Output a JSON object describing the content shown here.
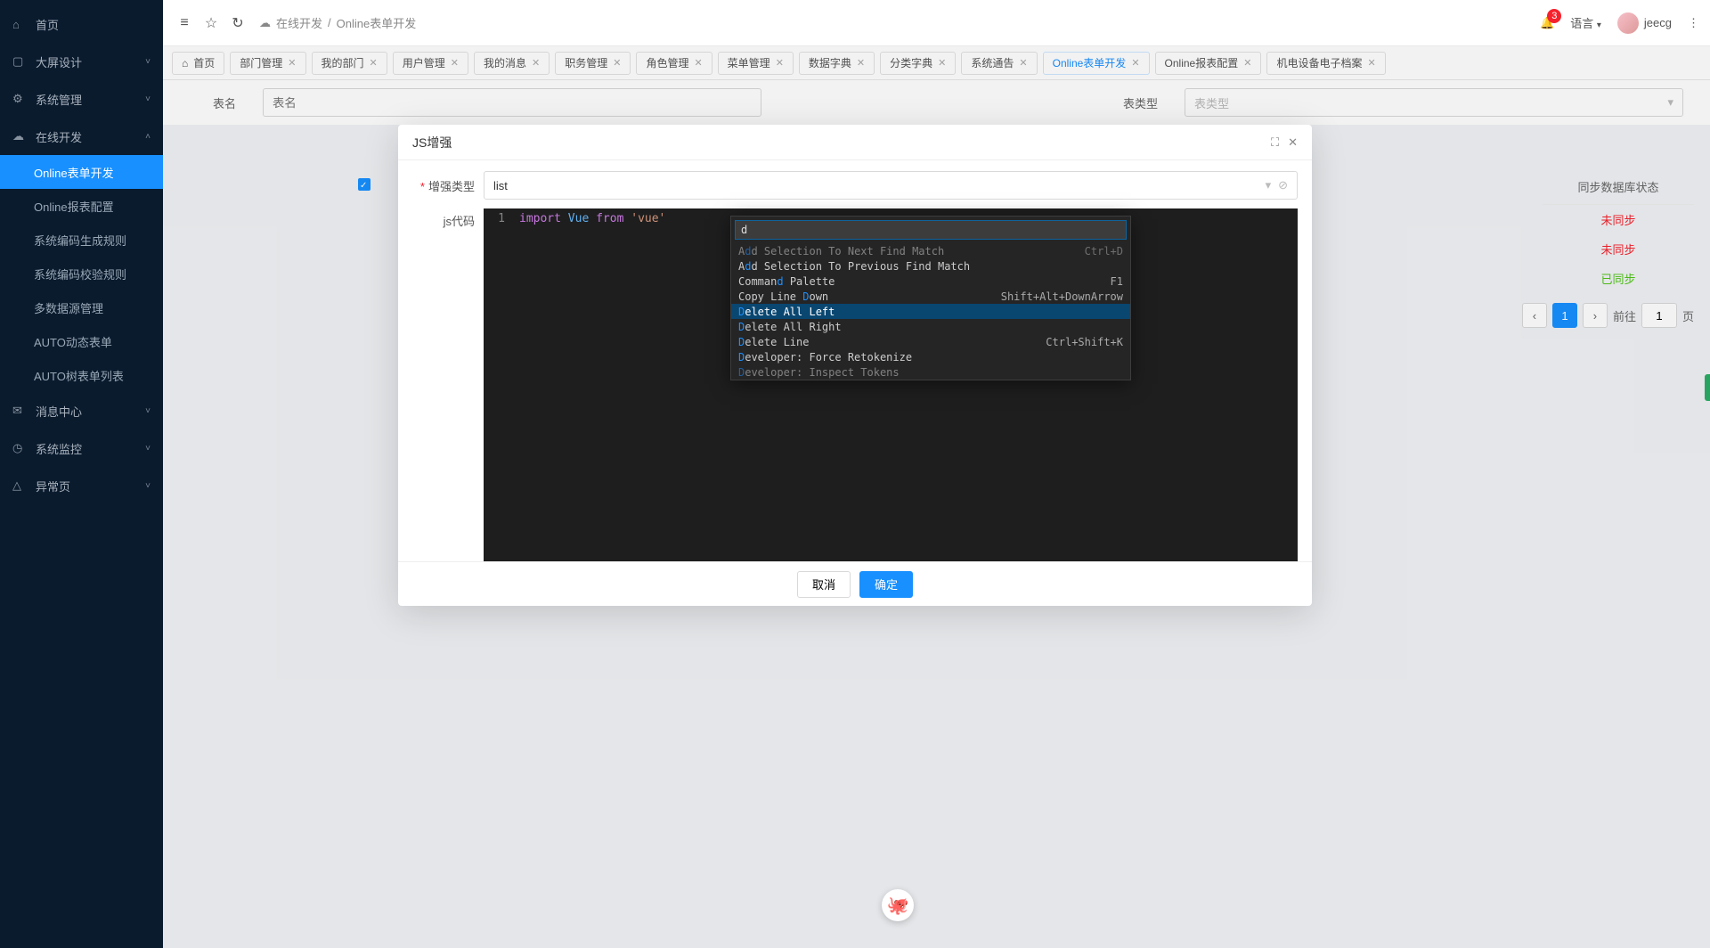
{
  "sidebar": {
    "items": [
      {
        "icon": "⌂",
        "label": "首页",
        "expandable": false
      },
      {
        "icon": "▢",
        "label": "大屏设计",
        "expandable": true
      },
      {
        "icon": "⚙",
        "label": "系统管理",
        "expandable": true
      },
      {
        "icon": "☁",
        "label": "在线开发",
        "expandable": true,
        "open": true,
        "children": [
          {
            "label": "Online表单开发",
            "active": true
          },
          {
            "label": "Online报表配置"
          },
          {
            "label": "系统编码生成规则"
          },
          {
            "label": "系统编码校验规则"
          },
          {
            "label": "多数据源管理"
          },
          {
            "label": "AUTO动态表单"
          },
          {
            "label": "AUTO树表单列表"
          }
        ]
      },
      {
        "icon": "✉",
        "label": "消息中心",
        "expandable": true
      },
      {
        "icon": "◷",
        "label": "系统监控",
        "expandable": true
      },
      {
        "icon": "△",
        "label": "异常页",
        "expandable": true
      }
    ]
  },
  "topbar": {
    "breadcrumb": {
      "icon_label": "在线开发",
      "current": "Online表单开发",
      "sep": "/"
    },
    "language_label": "语言",
    "user_name": "jeecg",
    "badge_count": "3"
  },
  "tabs": [
    {
      "label": "首页",
      "icon": "⌂",
      "closable": false
    },
    {
      "label": "部门管理"
    },
    {
      "label": "我的部门"
    },
    {
      "label": "用户管理"
    },
    {
      "label": "我的消息"
    },
    {
      "label": "职务管理"
    },
    {
      "label": "角色管理"
    },
    {
      "label": "菜单管理"
    },
    {
      "label": "数据字典"
    },
    {
      "label": "分类字典"
    },
    {
      "label": "系统通告"
    },
    {
      "label": "Online表单开发",
      "active": true
    },
    {
      "label": "Online报表配置"
    },
    {
      "label": "机电设备电子档案"
    }
  ],
  "search": {
    "name_label": "表名",
    "name_placeholder": "表名",
    "type_label": "表类型",
    "type_placeholder": "表类型"
  },
  "table": {
    "sync_header": "同步数据库状态",
    "rows": [
      {
        "sync": "未同步",
        "cls": "red",
        "checked": true
      },
      {
        "sync": "未同步",
        "cls": "red",
        "checked": false
      },
      {
        "sync": "已同步",
        "cls": "green",
        "checked": false
      }
    ]
  },
  "pager": {
    "page": "1",
    "goto_label": "前往",
    "goto_value": "1",
    "page_unit": "页"
  },
  "modal": {
    "title": "JS增强",
    "type_label": "增强类型",
    "type_value": "list",
    "code_label": "js代码",
    "editor": {
      "line_no": "1",
      "kw_import": "import",
      "id_vue": "Vue",
      "kw_from": "from",
      "str_vue": "'vue'"
    },
    "palette": {
      "input": "d",
      "items": [
        {
          "pre": "A",
          "hl": "d",
          "post": "d Selection To Next Find Match",
          "kb": "Ctrl+D",
          "sel": false,
          "dim": true
        },
        {
          "pre": "A",
          "hl": "d",
          "post": "d Selection To Previous Find Match",
          "kb": ""
        },
        {
          "pre": "Comman",
          "hl": "d",
          "post": " Palette",
          "kb": "F1"
        },
        {
          "pre": "Copy Line ",
          "hl": "D",
          "post": "own",
          "kb": "Shift+Alt+DownArrow"
        },
        {
          "pre": "",
          "hl": "D",
          "post": "elete All Left",
          "kb": "",
          "sel": true
        },
        {
          "pre": "",
          "hl": "D",
          "post": "elete All Right",
          "kb": ""
        },
        {
          "pre": "",
          "hl": "D",
          "post": "elete Line",
          "kb": "Ctrl+Shift+K"
        },
        {
          "pre": "",
          "hl": "D",
          "post": "eveloper: Force Retokenize",
          "kb": ""
        },
        {
          "pre": "",
          "hl": "D",
          "post": "eveloper: Inspect Tokens",
          "kb": "",
          "dim": true
        }
      ]
    },
    "footer": {
      "cancel": "取消",
      "ok": "确定"
    }
  }
}
